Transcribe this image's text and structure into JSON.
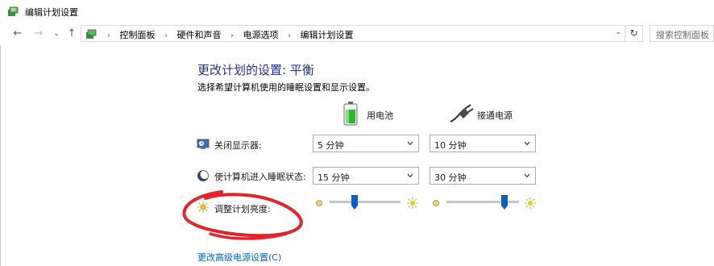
{
  "window": {
    "title": "编辑计划设置",
    "icon": "power-options-icon"
  },
  "address_bar": {
    "breadcrumbs": [
      "控制面板",
      "硬件和声音",
      "电源选项",
      "编辑计划设置"
    ],
    "search_placeholder": "搜索控制面板"
  },
  "page": {
    "heading": "更改计划的设置: 平衡",
    "subheading": "选择希望计算机使用的睡眠设置和显示设置。",
    "columns": {
      "on_battery": "用电池",
      "plugged_in": "接通电源"
    },
    "settings": {
      "display_off": {
        "label": "关闭显示器:",
        "on_battery": "5 分钟",
        "plugged_in": "10 分钟"
      },
      "sleep": {
        "label": "使计算机进入睡眠状态:",
        "on_battery": "15 分钟",
        "plugged_in": "30 分钟"
      },
      "brightness": {
        "label": "调整计划亮度:",
        "on_battery_level": 0.35,
        "plugged_in_level": 0.8
      }
    },
    "advanced_link": "更改高级电源设置(C)"
  },
  "colors": {
    "heading": "#1e3287",
    "link": "#0066cc",
    "slider_thumb": "#0c5ec4",
    "annotation": "#e0262a"
  }
}
